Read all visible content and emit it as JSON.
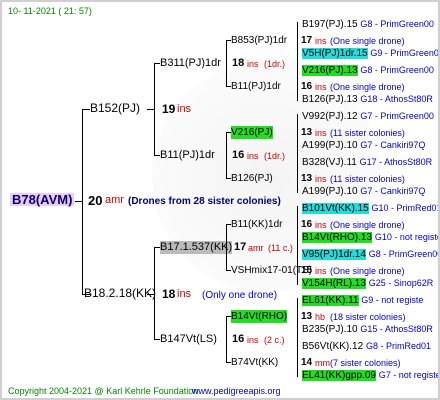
{
  "header": {
    "timestamp": "10- 11-2021 ( 21: 57)"
  },
  "root": {
    "id": "B78(AVM)",
    "size": "20",
    "unit": "amr",
    "note": "(Drones from 28 sister colonies)"
  },
  "gen1": [
    {
      "id": "B152(PJ)",
      "size": "19",
      "unit": "ins"
    },
    {
      "id": "B18.2.18(KK)",
      "size": "18",
      "unit": "ins",
      "note": "(Only one drone)"
    }
  ],
  "gen2": [
    {
      "id": "B311(PJ)1dr",
      "size": "18",
      "unit": "ins",
      "note": "(1dr.)"
    },
    {
      "id": "B11(PJ)1dr",
      "size": "16",
      "unit": "ins",
      "note": "(1dr.)"
    },
    {
      "id": "B17.1.537(KK)",
      "size": "17",
      "unit": "amr",
      "note": "(11 c.)"
    },
    {
      "id": "B147Vt(LS)",
      "size": "16",
      "unit": "ins",
      "note": "(2 c.)"
    }
  ],
  "gen3": [
    {
      "id": "B853(PJ)1dr",
      "size": "17",
      "unit": "ins",
      "note": "(One single drone)"
    },
    {
      "id": "B11(PJ)1dr",
      "size": "16",
      "unit": "ins",
      "note": "(One single drone)"
    },
    {
      "id": "V216(PJ)",
      "size": "13",
      "unit": "ins",
      "note": "(11 sister colonies)"
    },
    {
      "id": "B126(PJ)",
      "size": "13",
      "unit": "ins",
      "note": "(11 sister colonies)"
    },
    {
      "id": "B11(KK)1dr",
      "size": "16",
      "unit": "ins",
      "note": "(One single drone)"
    },
    {
      "id": "VSHmix17-01(TS)",
      "size": "15",
      "unit": "ins",
      "note": "(One single drone)"
    },
    {
      "id": "B14Vt(RHO)",
      "size": "13",
      "unit": "hb",
      "note": "(18 sister colonies)"
    },
    {
      "id": "B74Vt(KK)",
      "size": "14",
      "unit": "mm",
      "note": "(7 sister colonies)"
    }
  ],
  "gen4": [
    {
      "id": "B197(PJ).15",
      "nav": "G8 - PrimGreen00"
    },
    {
      "id": "V5H(PJ)1dr.15",
      "nav": "G9 - PrimGreen00"
    },
    {
      "id": "V216(PJ).13",
      "nav": "G8 - PrimGreen00"
    },
    {
      "id": "B126(PJ).13",
      "nav": "G18 - AthosSt80R"
    },
    {
      "id": "V992(PJ).12",
      "nav": "G7 - PrimGreen00"
    },
    {
      "id": "A199(PJ).10",
      "nav": "G7 - Cankiri97Q"
    },
    {
      "id": "B328(VJ).11",
      "nav": "G17 - AthosSt80R"
    },
    {
      "id": "A199(PJ).10",
      "nav": "G7 - Cankiri97Q"
    },
    {
      "id": "B101Vt(KK).15",
      "nav": "G10 - PrimRed01"
    },
    {
      "id": "B14Vt(RHO).13",
      "nav": "G10 - not registe"
    },
    {
      "id": "V95(PJ)1dr.14",
      "nav": "G8 - PrimGreen00"
    },
    {
      "id": "V154H(RL).13",
      "nav": "G25 - Sinop62R"
    },
    {
      "id": "EL61(KK).11",
      "nav": "G9 - not registe"
    },
    {
      "id": "B235(PJ).10",
      "nav": "G15 - AthosSt80R"
    },
    {
      "id": "B56Vt(KK).12",
      "nav": "G8 - PrimRed01"
    },
    {
      "id": "EL41(KK)gpp.09",
      "nav": "G7 - not registe"
    }
  ],
  "footer": {
    "copyright": "Copyright 2004-2021 @ Karl Kehrle Foundation",
    "site": "www.pedigreeapis.org"
  },
  "colors": {
    "link": "#0000cc",
    "accent": "#cc0000",
    "highlight": "#22dd22",
    "cyan": "#22dddd"
  }
}
